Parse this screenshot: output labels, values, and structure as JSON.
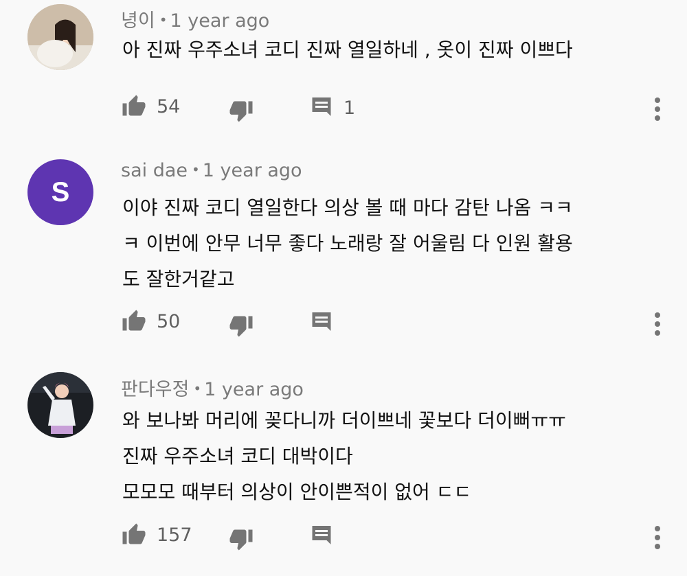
{
  "comments": [
    {
      "author": "녕이",
      "time": "1 year ago",
      "text": "아 진짜 우주소녀 코디 진짜 열일하네 , 옷이 진짜 이쁘다",
      "likes": "54",
      "replies": "1"
    },
    {
      "author": "sai dae",
      "avatar_letter": "S",
      "time": "1 year ago",
      "text": "이야 진짜 코디 열일한다 의상 볼 때 마다 감탄 나옴 ㅋㅋ\nㅋ 이번에 안무 너무 좋다 노래랑 잘 어울림 다 인원 활용\n도 잘한거같고",
      "likes": "50",
      "replies": ""
    },
    {
      "author": "판다우정",
      "time": "1 year ago",
      "text": "와 보나봐 머리에 꽂다니까 더이쁘네 꽃보다 더이뻐ㅠㅠ\n진짜 우주소녀 코디 대박이다\n모모모 때부터 의상이 안이쁜적이 없어 ㄷㄷ",
      "likes": "157",
      "replies": ""
    }
  ],
  "dot": "•",
  "colors": {
    "background": "#f9f9f9",
    "avatar_letter_bg": "#5e35b1",
    "meta": "#7a7a7a",
    "icon": "#757575"
  },
  "icons": [
    "thumbs-up-icon",
    "thumbs-down-icon",
    "reply-icon",
    "more-vert-icon"
  ]
}
